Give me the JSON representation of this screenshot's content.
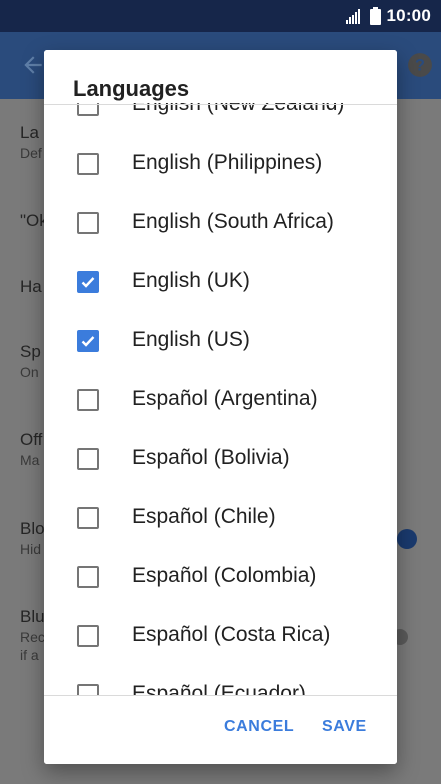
{
  "status_bar": {
    "time": "10:00",
    "signal_icon": "signal-icon",
    "battery_icon": "battery-icon"
  },
  "app_bar": {
    "back_icon": "arrow-back-icon",
    "help_icon": "help-icon"
  },
  "background_items": [
    {
      "title": "La",
      "subtitle": "Def"
    },
    {
      "title": "\"Ok",
      "subtitle": ""
    },
    {
      "title": "Ha",
      "subtitle": ""
    },
    {
      "title": "Sp",
      "subtitle": "On"
    },
    {
      "title": "Off",
      "subtitle": "Ma"
    },
    {
      "title": "Blo",
      "subtitle": "Hid"
    },
    {
      "title": "Blu",
      "subtitle": "Rec",
      "subtitle2": "if a"
    }
  ],
  "dialog": {
    "title": "Languages",
    "languages": [
      {
        "label": "English (New Zealand)",
        "checked": false
      },
      {
        "label": "English (Philippines)",
        "checked": false
      },
      {
        "label": "English (South Africa)",
        "checked": false
      },
      {
        "label": "English (UK)",
        "checked": true
      },
      {
        "label": "English (US)",
        "checked": true
      },
      {
        "label": "Español (Argentina)",
        "checked": false
      },
      {
        "label": "Español (Bolivia)",
        "checked": false
      },
      {
        "label": "Español (Chile)",
        "checked": false
      },
      {
        "label": "Español (Colombia)",
        "checked": false
      },
      {
        "label": "Español (Costa Rica)",
        "checked": false
      },
      {
        "label": "Español (Ecuador)",
        "checked": false
      }
    ],
    "cancel_label": "CANCEL",
    "save_label": "SAVE",
    "accent_color": "#3b7cdc"
  }
}
